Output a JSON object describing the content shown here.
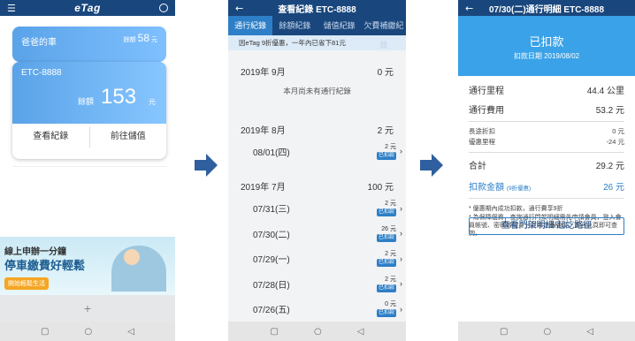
{
  "screen1": {
    "logo": "eTag",
    "small_card": {
      "name": "爸爸的車",
      "balance_label": "餘額",
      "balance": "58",
      "unit": "元"
    },
    "main_card": {
      "plate": "ETC-8888",
      "balance_label": "餘額",
      "balance": "153",
      "unit": "元",
      "records_button": "查看紀錄",
      "topup_button": "前往儲值"
    },
    "banner": {
      "line1": "線上申辦一分鐘",
      "line2": "停車繳費好輕鬆",
      "cta": "開始輕鬆生活"
    },
    "add_symbol": "+"
  },
  "screen2": {
    "title": "查看紀錄 ETC-8888",
    "tabs": [
      "通行紀錄",
      "餘額紀錄",
      "儲值紀錄",
      "欠費補繳紀錄"
    ],
    "promo": "因eTag 9折優惠，一年內已省下81元",
    "sections": [
      {
        "month": "2019年 9月",
        "total": "0 元",
        "empty": "本月尚未有通行紀錄"
      },
      {
        "month": "2019年 8月",
        "total": "2 元"
      },
      {
        "month": "2019年 7月",
        "total": "100 元"
      }
    ],
    "aug_rows": [
      {
        "date": "08/01(四)",
        "amount": "2 元",
        "status": "已扣款"
      }
    ],
    "jul_rows": [
      {
        "date": "07/31(三)",
        "amount": "2 元",
        "status": "已扣款"
      },
      {
        "date": "07/30(二)",
        "amount": "26 元",
        "status": "已扣款"
      },
      {
        "date": "07/29(一)",
        "amount": "2 元",
        "status": "已扣款"
      },
      {
        "date": "07/28(日)",
        "amount": "2 元",
        "status": "已扣款"
      },
      {
        "date": "07/26(五)",
        "amount": "0 元",
        "status": "已扣款"
      }
    ]
  },
  "screen3": {
    "title": "07/30(二)通行明細 ETC-8888",
    "status": "已扣款",
    "deduct_date": "扣款日期 2019/08/02",
    "mileage_label": "通行里程",
    "mileage": "44.4 公里",
    "fee_label": "通行費用",
    "fee": "53.2 元",
    "long_discount_label": "長途折扣",
    "long_discount": "0 元",
    "free_mileage_label": "優惠里程",
    "free_mileage": "-24 元",
    "total_label": "合計",
    "total": "29.2 元",
    "deduct_label": "扣款金額",
    "deduct_note": "(9折優惠)",
    "deduct_amount": "26 元",
    "note1": "* 優惠期內成功扣款，通行費享9折",
    "note2": "* 為保障個資，查詢通行門架明細需先申請會員，登入會員帳號、密碼驗證身分並綁定車號後，重回此頁即可查詢。",
    "button": "查看門架明細/起訖路徑"
  },
  "nav": {
    "square": "▢",
    "circle": "○",
    "back": "◁"
  }
}
